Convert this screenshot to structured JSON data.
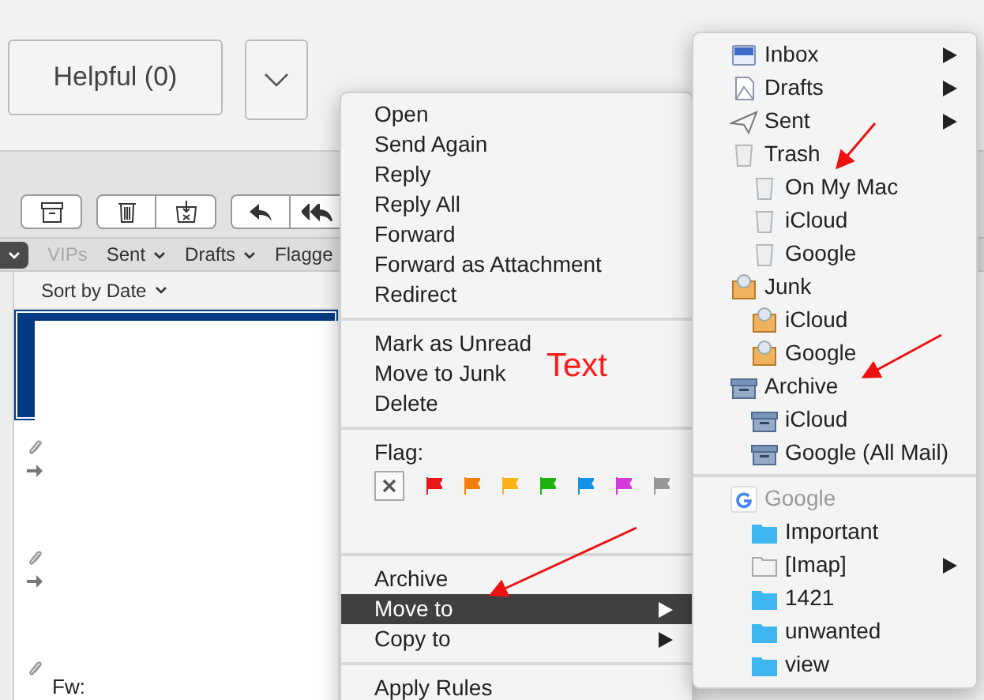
{
  "feedback": {
    "helpful_button": "Helpful (0)"
  },
  "favorites_bar": [
    {
      "label": "VIPs",
      "disabled": true
    },
    {
      "label": "Sent",
      "disabled": false
    },
    {
      "label": "Drafts",
      "disabled": false
    },
    {
      "label": "Flagge",
      "disabled": false
    }
  ],
  "message_list": {
    "sort": "Sort by Date",
    "rows": [
      {
        "selected": true,
        "attachment": false,
        "forwarded": false
      },
      {
        "selected": false,
        "attachment": true,
        "forwarded": true
      },
      {
        "selected": false,
        "attachment": true,
        "forwarded": true
      },
      {
        "selected": false,
        "attachment": true,
        "forwarded": false,
        "subject": "Fw:"
      }
    ]
  },
  "context_menu": {
    "sections": [
      {
        "items": [
          {
            "label": "Open"
          },
          {
            "label": "Send Again"
          },
          {
            "label": "Reply"
          },
          {
            "label": "Reply All"
          },
          {
            "label": "Forward"
          },
          {
            "label": "Forward as Attachment"
          },
          {
            "label": "Redirect"
          }
        ]
      },
      {
        "items": [
          {
            "label": "Mark as Unread"
          },
          {
            "label": "Move to Junk"
          },
          {
            "label": "Delete"
          }
        ]
      },
      {
        "flag_label": "Flag:",
        "flags": [
          {
            "color": "#e8151b"
          },
          {
            "color": "#f27f0c"
          },
          {
            "color": "#fbb416"
          },
          {
            "color": "#1db30d"
          },
          {
            "color": "#1591e9"
          },
          {
            "color": "#d43ad7"
          },
          {
            "color": "#989898"
          }
        ]
      },
      {
        "items": [
          {
            "label": "Archive",
            "selected": false,
            "has_submenu": false
          },
          {
            "label": "Move to",
            "selected": true,
            "has_submenu": true
          },
          {
            "label": "Copy to",
            "selected": false,
            "has_submenu": true
          }
        ]
      },
      {
        "items": [
          {
            "label": "Apply Rules"
          }
        ]
      }
    ]
  },
  "submenu": {
    "sections": [
      {
        "items": [
          {
            "label": "Inbox",
            "kind": "inbox",
            "has_submenu": true
          },
          {
            "label": "Drafts",
            "kind": "drafts",
            "has_submenu": true
          },
          {
            "label": "Sent",
            "kind": "sent",
            "has_submenu": true
          },
          {
            "label": "Trash",
            "kind": "trash",
            "children": [
              {
                "label": "On My Mac",
                "kind": "trash"
              },
              {
                "label": "iCloud",
                "kind": "trash"
              },
              {
                "label": "Google",
                "kind": "trash"
              }
            ]
          },
          {
            "label": "Junk",
            "kind": "junk",
            "children": [
              {
                "label": "iCloud",
                "kind": "junk"
              },
              {
                "label": "Google",
                "kind": "junk"
              }
            ]
          },
          {
            "label": "Archive",
            "kind": "archive",
            "children": [
              {
                "label": "iCloud",
                "kind": "archive"
              },
              {
                "label": "Google (All Mail)",
                "kind": "archive"
              }
            ]
          }
        ]
      },
      {
        "items": [
          {
            "label": "Google",
            "kind": "account",
            "disabled": true,
            "children": [
              {
                "label": "Important",
                "kind": "folder"
              },
              {
                "label": "[Imap]",
                "kind": "plain-folder",
                "has_submenu": true
              },
              {
                "label": "1421",
                "kind": "folder"
              },
              {
                "label": "unwanted",
                "kind": "folder"
              },
              {
                "label": "view",
                "kind": "folder"
              }
            ]
          }
        ]
      }
    ]
  },
  "annotation": {
    "text": "Text"
  }
}
